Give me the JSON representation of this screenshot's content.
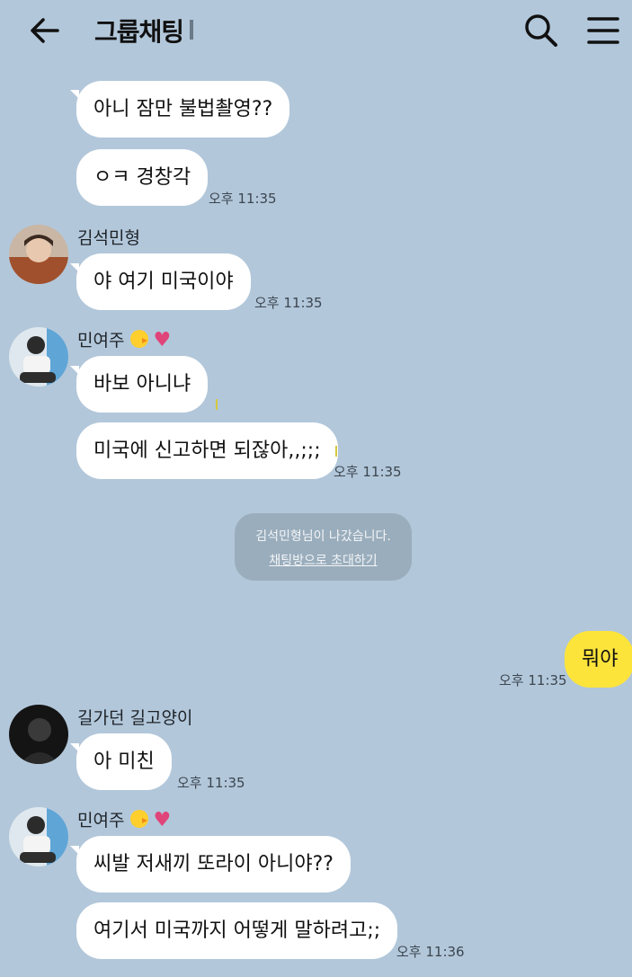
{
  "header": {
    "title": "그룹채팅",
    "back_icon": "arrow-left-icon",
    "search_icon": "search-icon",
    "menu_icon": "hamburger-menu-icon"
  },
  "colors": {
    "background": "#b2c7da",
    "bubble_other": "#ffffff",
    "bubble_mine": "#fde43b",
    "notice": "#9aadbc"
  },
  "messages": [
    {
      "text": "아니 잠만 불법촬영??"
    },
    {
      "text": "ㅇㅋ 경창각",
      "time": "오후 11:35"
    },
    {
      "sender": "김석민형",
      "text": "야 여기 미국이야",
      "time": "오후 11:35"
    },
    {
      "sender": "민여주",
      "text": "바보 아니냐"
    },
    {
      "text": "미국에 신고하면 되잖아,,;;;",
      "time": "오후 11:35"
    },
    {
      "text": "뭐야",
      "time": "오후 11:35",
      "mine": true
    },
    {
      "sender": "길가던 길고양이",
      "text": "아 미친",
      "time": "오후 11:35"
    },
    {
      "sender": "민여주",
      "text": "씨발 저새끼 또라이 아니야??"
    },
    {
      "text": "여기서 미국까지 어떻게 말하려고;;",
      "time": "오후 11:36"
    }
  ],
  "notice": {
    "text": "김석민형님이 나갔습니다.",
    "link": "채팅방으로 초대하기"
  }
}
